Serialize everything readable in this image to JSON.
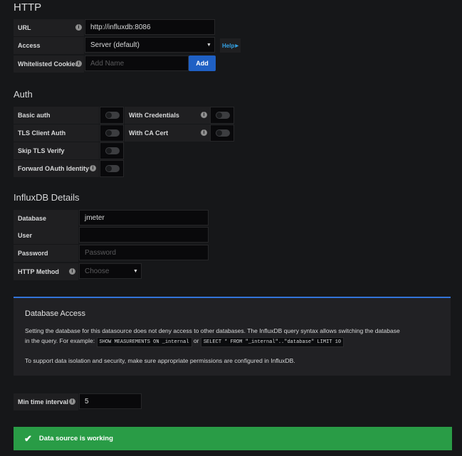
{
  "http": {
    "heading": "HTTP",
    "url_label": "URL",
    "url_value": "http://influxdb:8086",
    "access_label": "Access",
    "access_value": "Server (default)",
    "help_label": "Help",
    "cookies_label": "Whitelisted Cookies",
    "cookies_placeholder": "Add Name",
    "add_label": "Add"
  },
  "auth": {
    "heading": "Auth",
    "basic_auth": "Basic auth",
    "with_credentials": "With Credentials",
    "tls_client_auth": "TLS Client Auth",
    "with_ca_cert": "With CA Cert",
    "skip_tls_verify": "Skip TLS Verify",
    "forward_oauth": "Forward OAuth Identity"
  },
  "influx": {
    "heading": "InfluxDB Details",
    "database_label": "Database",
    "database_value": "jmeter",
    "user_label": "User",
    "user_value": "",
    "password_label": "Password",
    "password_placeholder": "Password",
    "method_label": "HTTP Method",
    "method_placeholder": "Choose"
  },
  "notice": {
    "title": "Database Access",
    "line1": "Setting the database for this datasource does not deny access to other databases. The InfluxDB query syntax allows switching the database",
    "line2_prefix": "in the query. For example:",
    "code1": "SHOW MEASUREMENTS ON _internal",
    "or_text": "or",
    "code2": "SELECT * FROM \"_internal\"..\"database\" LIMIT 10",
    "line3": "To support data isolation and security, make sure appropriate permissions are configured in InfluxDB."
  },
  "interval": {
    "label": "Min time interval",
    "value": "5"
  },
  "status": {
    "message": "Data source is working",
    "color": "#299c46"
  },
  "icons": {
    "info": "info-icon",
    "caret": "caret-down-icon",
    "check": "check-icon"
  }
}
